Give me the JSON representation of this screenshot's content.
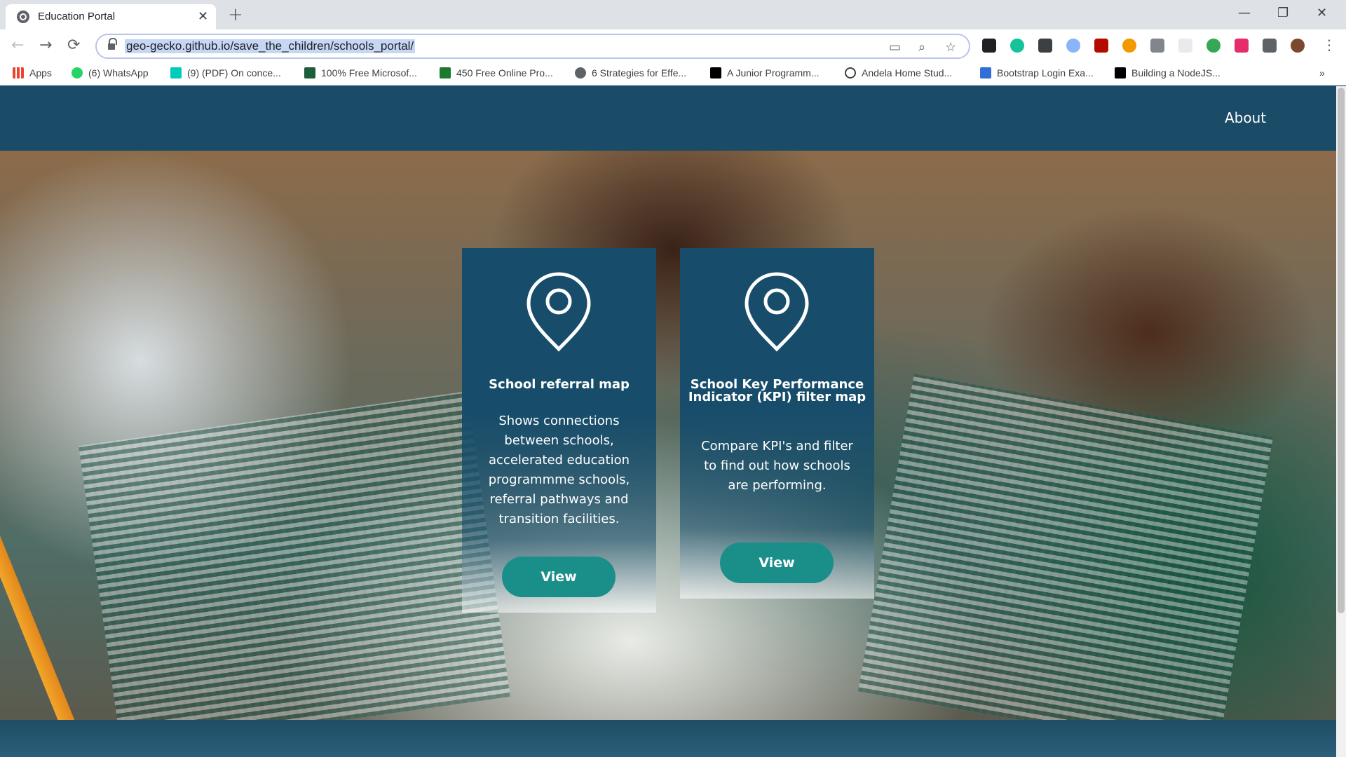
{
  "browser": {
    "tab_title": "Education Portal",
    "close_tab": "✕",
    "new_tab": "+",
    "url": "geo-gecko.github.io/save_the_children/schools_portal/",
    "window_controls": {
      "minimize": "—",
      "maximize": "❐",
      "close": "✕"
    },
    "nav": {
      "back": "←",
      "forward": "→",
      "reload": "⟳"
    },
    "more_menu": "⋮"
  },
  "bookmarks": {
    "items": [
      {
        "label": "Apps",
        "icon": "apps-grid-icon",
        "color": "#e94235"
      },
      {
        "label": "(6) WhatsApp",
        "icon": "whatsapp-icon",
        "color": "#25d366"
      },
      {
        "label": "(9) (PDF) On conce...",
        "icon": "researchgate-icon",
        "color": "#00ccbb"
      },
      {
        "label": "100% Free Microsof...",
        "icon": "pa-icon",
        "color": "#1d5e3a"
      },
      {
        "label": "450 Free Online Pro...",
        "icon": "green-book-icon",
        "color": "#1b7a2e"
      },
      {
        "label": "6 Strategies for Effe...",
        "icon": "globe-icon",
        "color": "#5f6368"
      },
      {
        "label": "A Junior Programm...",
        "icon": "medium-icon",
        "color": "#000000"
      },
      {
        "label": "Andela Home Stud...",
        "icon": "andela-icon",
        "color": "#3c4043"
      },
      {
        "label": "Bootstrap Login Exa...",
        "icon": "bootstrap-icon",
        "color": "#2f6fd6"
      },
      {
        "label": "Building a NodeJS...",
        "icon": "dev-icon",
        "color": "#000000"
      }
    ],
    "overflow": "»"
  },
  "site": {
    "nav_about": "About",
    "cards": [
      {
        "title": "School referral map",
        "description": "Shows connections between schools, accelerated education programmme schools, referral pathways and transition facilities.",
        "button": "View"
      },
      {
        "title": "School Key Performance Indicator (KPI) filter map",
        "description": "Compare KPI's and filter to find out how schools are performing.",
        "button": "View"
      }
    ]
  },
  "colors": {
    "nav_bg": "#1a4b67",
    "card_bg": "#174d6b",
    "button_bg": "#1a8f89"
  }
}
